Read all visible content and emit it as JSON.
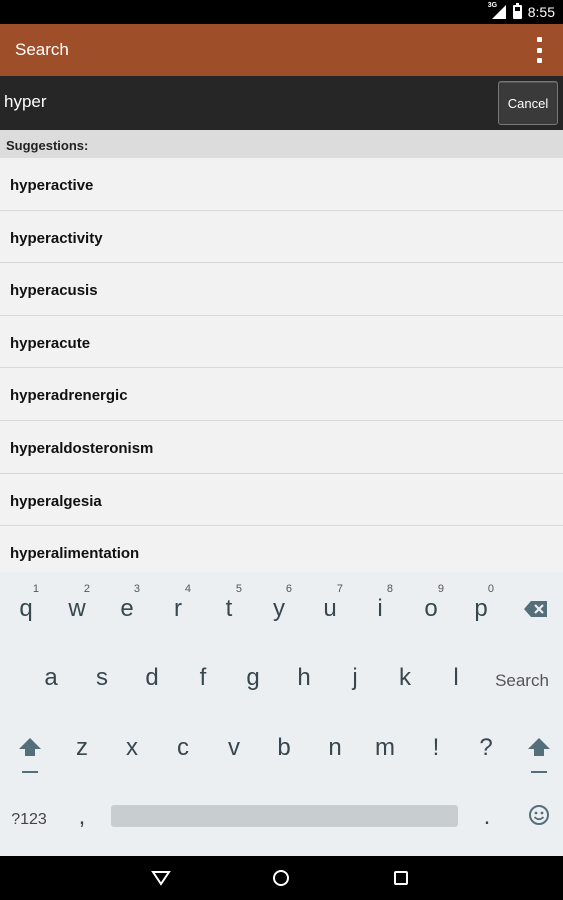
{
  "status_bar": {
    "network_tag": "3G",
    "time": "8:55"
  },
  "app_bar": {
    "title": "Search"
  },
  "search": {
    "value": "hyper",
    "cancel_label": "Cancel"
  },
  "suggestions": {
    "header": "Suggestions:",
    "items": [
      "hyperactive",
      "hyperactivity",
      "hyperacusis",
      "hyperacute",
      "hyperadrenergic",
      "hyperaldosteronism",
      "hyperalgesia",
      "hyperalimentation"
    ]
  },
  "keyboard": {
    "row1": [
      {
        "ch": "q",
        "hint": "1"
      },
      {
        "ch": "w",
        "hint": "2"
      },
      {
        "ch": "e",
        "hint": "3"
      },
      {
        "ch": "r",
        "hint": "4"
      },
      {
        "ch": "t",
        "hint": "5"
      },
      {
        "ch": "y",
        "hint": "6"
      },
      {
        "ch": "u",
        "hint": "7"
      },
      {
        "ch": "i",
        "hint": "8"
      },
      {
        "ch": "o",
        "hint": "9"
      },
      {
        "ch": "p",
        "hint": "0"
      }
    ],
    "row2": [
      "a",
      "s",
      "d",
      "f",
      "g",
      "h",
      "j",
      "k",
      "l"
    ],
    "row2_action": "Search",
    "row3": [
      "z",
      "x",
      "c",
      "v",
      "b",
      "n",
      "m",
      "!",
      "?"
    ],
    "symbols_label": "?123",
    "comma": ",",
    "period": "."
  },
  "colors": {
    "app_bar": "#9e4f2a",
    "search_row": "#262626",
    "keyboard_bg": "#eceff1"
  },
  "icons": [
    "backspace-icon",
    "shift-icon",
    "emoji-icon",
    "overflow-menu-icon",
    "back-nav-icon",
    "home-nav-icon",
    "recents-nav-icon"
  ]
}
